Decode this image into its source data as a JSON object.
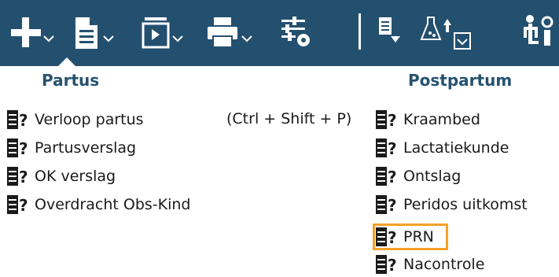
{
  "toolbar": {
    "icons": [
      "add-icon",
      "new-document-icon",
      "presentation-icon",
      "print-icon",
      "settings-sliders-icon",
      "list-download-icon",
      "lab-upload-icon",
      "checkbox-icon",
      "pictogram-icon"
    ],
    "background": "#24506f",
    "foreground": "#ffffff"
  },
  "menu": {
    "partus": {
      "title": "Partus",
      "items": [
        {
          "label": "Verloop partus",
          "shortcut": "(Ctrl + Shift + P)"
        },
        {
          "label": "Partusverslag"
        },
        {
          "label": "OK verslag"
        },
        {
          "label": "Overdracht Obs-Kind"
        }
      ]
    },
    "postpartum": {
      "title": "Postpartum",
      "items": [
        {
          "label": "Kraambed"
        },
        {
          "label": "Lactatiekunde"
        },
        {
          "label": "Ontslag"
        },
        {
          "label": "Peridos uitkomst"
        },
        {
          "label": "PRN",
          "highlighted": true
        },
        {
          "label": "Nacontrole"
        }
      ]
    }
  },
  "colors": {
    "section_title": "#26526f",
    "highlight": "#f4a12a"
  }
}
